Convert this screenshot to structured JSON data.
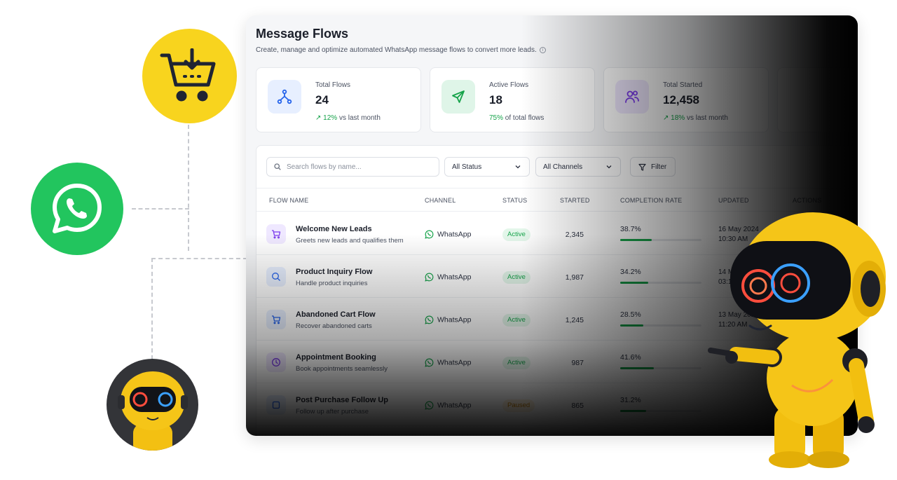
{
  "panel": {
    "title": "Message Flows",
    "subtitle": "Create, manage and optimize automated WhatsApp message flows to convert more leads."
  },
  "stats": [
    {
      "label": "Total Flows",
      "value": "24",
      "note_highlight": "12%",
      "note_rest": "vs last month",
      "icon": "flow-icon",
      "color": "#2563eb"
    },
    {
      "label": "Active Flows",
      "value": "18",
      "note_highlight": "75%",
      "note_rest": "of total flows",
      "icon": "send-icon",
      "color": "#16a34a"
    },
    {
      "label": "Total Started",
      "value": "12,458",
      "note_highlight": "18%",
      "note_rest": "vs last month",
      "icon": "users-icon",
      "color": "#7c3aed"
    }
  ],
  "filters": {
    "search_placeholder": "Search flows by name...",
    "status": "All Status",
    "channels": "All Channels",
    "filter_label": "Filter"
  },
  "table": {
    "columns": [
      "FLOW NAME",
      "CHANNEL",
      "STATUS",
      "STARTED",
      "COMPLETION RATE",
      "UPDATED",
      "ACTIONS"
    ],
    "rows": [
      {
        "name": "Welcome New Leads",
        "desc": "Greets new leads and qualifies them",
        "channel": "WhatsApp",
        "status": "Active",
        "started": "2,345",
        "rate": "38.7%",
        "rate_value": 0.387,
        "updated": "16 May 2024",
        "updated_time": "10:30 AM",
        "icon": "cart-icon"
      },
      {
        "name": "Product Inquiry Flow",
        "desc": "Handle product inquiries",
        "channel": "WhatsApp",
        "status": "Active",
        "started": "1,987",
        "rate": "34.2%",
        "rate_value": 0.342,
        "updated": "14 May 2024",
        "updated_time": "03:15 PM",
        "icon": "search-chat-icon"
      },
      {
        "name": "Abandoned Cart Flow",
        "desc": "Recover abandoned carts",
        "channel": "WhatsApp",
        "status": "Active",
        "started": "1,245",
        "rate": "28.5%",
        "rate_value": 0.285,
        "updated": "13 May 2024",
        "updated_time": "11:20 AM",
        "icon": "cart-icon"
      },
      {
        "name": "Appointment Booking",
        "desc": "Book appointments seamlessly",
        "channel": "WhatsApp",
        "status": "Active",
        "started": "987",
        "rate": "41.6%",
        "rate_value": 0.416,
        "updated": "",
        "updated_time": "",
        "icon": "clock-icon"
      },
      {
        "name": "Post Purchase Follow Up",
        "desc": "Follow up after purchase",
        "channel": "WhatsApp",
        "status": "Paused",
        "started": "865",
        "rate": "31.2%",
        "rate_value": 0.312,
        "updated": "",
        "updated_time": "",
        "icon": "box-icon"
      }
    ]
  },
  "colors": {
    "accent_green": "#16a34a",
    "whatsapp_green": "#22c55e",
    "cart_yellow": "#f8d41e"
  }
}
